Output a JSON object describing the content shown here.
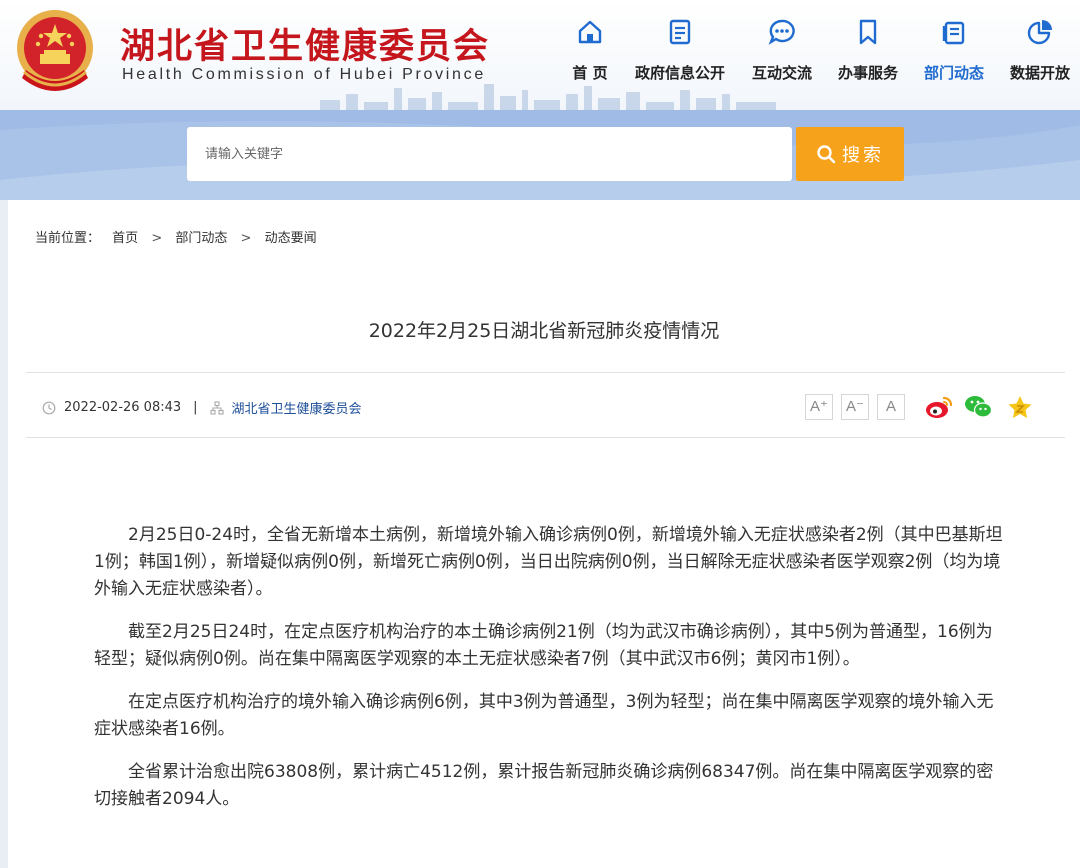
{
  "header": {
    "title": "湖北省卫生健康委员会",
    "subtitle": "Health Commission of Hubei Province",
    "nav": [
      {
        "label": "首  页",
        "icon": "home-icon"
      },
      {
        "label": "政府信息公开",
        "icon": "document-icon"
      },
      {
        "label": "互动交流",
        "icon": "chat-icon"
      },
      {
        "label": "办事服务",
        "icon": "bookmark-icon"
      },
      {
        "label": "部门动态",
        "icon": "news-icon",
        "active": true
      },
      {
        "label": "数据开放",
        "icon": "pie-chart-icon"
      }
    ]
  },
  "search": {
    "placeholder": "请输入关键字",
    "button_label": "搜索"
  },
  "breadcrumb": {
    "prefix": "当前位置：",
    "items": [
      "首页",
      "部门动态",
      "动态要闻"
    ],
    "separator": ">"
  },
  "article": {
    "title": "2022年2月25日湖北省新冠肺炎疫情情况",
    "date": "2022-02-26 08:43",
    "pipe": "|",
    "source": "湖北省卫生健康委员会",
    "font_buttons": [
      "A⁺",
      "A⁻",
      "A"
    ],
    "share_icons": [
      "weibo-icon",
      "wechat-icon",
      "favorite-star-icon"
    ],
    "paragraphs": [
      "2月25日0-24时，全省无新增本土病例，新增境外输入确诊病例0例，新增境外输入无症状感染者2例（其中巴基斯坦1例；韩国1例），新增疑似病例0例，新增死亡病例0例，当日出院病例0例，当日解除无症状感染者医学观察2例（均为境外输入无症状感染者）。",
      "截至2月25日24时，在定点医疗机构治疗的本土确诊病例21例（均为武汉市确诊病例），其中5例为普通型，16例为轻型；疑似病例0例。尚在集中隔离医学观察的本土无症状感染者7例（其中武汉市6例；黄冈市1例）。",
      "在定点医疗机构治疗的境外输入确诊病例6例，其中3例为普通型，3例为轻型；尚在集中隔离医学观察的境外输入无症状感染者16例。",
      "全省累计治愈出院63808例，累计病亡4512例，累计报告新冠肺炎确诊病例68347例。尚在集中隔离医学观察的密切接触者2094人。"
    ]
  },
  "colors": {
    "brand_red": "#c4161c",
    "nav_active": "#1f6bd0",
    "search_band": "#a9c3e8",
    "search_button": "#f7a21b",
    "source_link": "#1e4f99",
    "weibo": "#e6162d",
    "wechat": "#2dbb3c",
    "star": "#f5c518"
  }
}
